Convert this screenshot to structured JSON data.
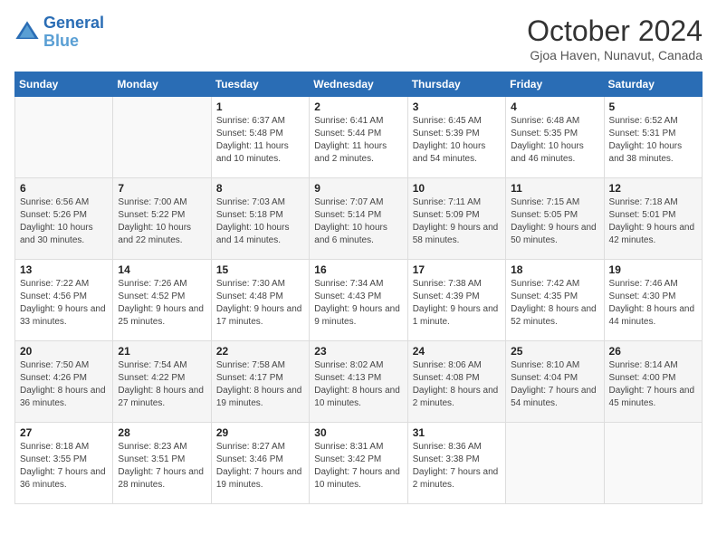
{
  "logo": {
    "line1": "General",
    "line2": "Blue"
  },
  "title": "October 2024",
  "location": "Gjoa Haven, Nunavut, Canada",
  "headers": [
    "Sunday",
    "Monday",
    "Tuesday",
    "Wednesday",
    "Thursday",
    "Friday",
    "Saturday"
  ],
  "weeks": [
    [
      {
        "day": "",
        "sunrise": "",
        "sunset": "",
        "daylight": ""
      },
      {
        "day": "",
        "sunrise": "",
        "sunset": "",
        "daylight": ""
      },
      {
        "day": "1",
        "sunrise": "Sunrise: 6:37 AM",
        "sunset": "Sunset: 5:48 PM",
        "daylight": "Daylight: 11 hours and 10 minutes."
      },
      {
        "day": "2",
        "sunrise": "Sunrise: 6:41 AM",
        "sunset": "Sunset: 5:44 PM",
        "daylight": "Daylight: 11 hours and 2 minutes."
      },
      {
        "day": "3",
        "sunrise": "Sunrise: 6:45 AM",
        "sunset": "Sunset: 5:39 PM",
        "daylight": "Daylight: 10 hours and 54 minutes."
      },
      {
        "day": "4",
        "sunrise": "Sunrise: 6:48 AM",
        "sunset": "Sunset: 5:35 PM",
        "daylight": "Daylight: 10 hours and 46 minutes."
      },
      {
        "day": "5",
        "sunrise": "Sunrise: 6:52 AM",
        "sunset": "Sunset: 5:31 PM",
        "daylight": "Daylight: 10 hours and 38 minutes."
      }
    ],
    [
      {
        "day": "6",
        "sunrise": "Sunrise: 6:56 AM",
        "sunset": "Sunset: 5:26 PM",
        "daylight": "Daylight: 10 hours and 30 minutes."
      },
      {
        "day": "7",
        "sunrise": "Sunrise: 7:00 AM",
        "sunset": "Sunset: 5:22 PM",
        "daylight": "Daylight: 10 hours and 22 minutes."
      },
      {
        "day": "8",
        "sunrise": "Sunrise: 7:03 AM",
        "sunset": "Sunset: 5:18 PM",
        "daylight": "Daylight: 10 hours and 14 minutes."
      },
      {
        "day": "9",
        "sunrise": "Sunrise: 7:07 AM",
        "sunset": "Sunset: 5:14 PM",
        "daylight": "Daylight: 10 hours and 6 minutes."
      },
      {
        "day": "10",
        "sunrise": "Sunrise: 7:11 AM",
        "sunset": "Sunset: 5:09 PM",
        "daylight": "Daylight: 9 hours and 58 minutes."
      },
      {
        "day": "11",
        "sunrise": "Sunrise: 7:15 AM",
        "sunset": "Sunset: 5:05 PM",
        "daylight": "Daylight: 9 hours and 50 minutes."
      },
      {
        "day": "12",
        "sunrise": "Sunrise: 7:18 AM",
        "sunset": "Sunset: 5:01 PM",
        "daylight": "Daylight: 9 hours and 42 minutes."
      }
    ],
    [
      {
        "day": "13",
        "sunrise": "Sunrise: 7:22 AM",
        "sunset": "Sunset: 4:56 PM",
        "daylight": "Daylight: 9 hours and 33 minutes."
      },
      {
        "day": "14",
        "sunrise": "Sunrise: 7:26 AM",
        "sunset": "Sunset: 4:52 PM",
        "daylight": "Daylight: 9 hours and 25 minutes."
      },
      {
        "day": "15",
        "sunrise": "Sunrise: 7:30 AM",
        "sunset": "Sunset: 4:48 PM",
        "daylight": "Daylight: 9 hours and 17 minutes."
      },
      {
        "day": "16",
        "sunrise": "Sunrise: 7:34 AM",
        "sunset": "Sunset: 4:43 PM",
        "daylight": "Daylight: 9 hours and 9 minutes."
      },
      {
        "day": "17",
        "sunrise": "Sunrise: 7:38 AM",
        "sunset": "Sunset: 4:39 PM",
        "daylight": "Daylight: 9 hours and 1 minute."
      },
      {
        "day": "18",
        "sunrise": "Sunrise: 7:42 AM",
        "sunset": "Sunset: 4:35 PM",
        "daylight": "Daylight: 8 hours and 52 minutes."
      },
      {
        "day": "19",
        "sunrise": "Sunrise: 7:46 AM",
        "sunset": "Sunset: 4:30 PM",
        "daylight": "Daylight: 8 hours and 44 minutes."
      }
    ],
    [
      {
        "day": "20",
        "sunrise": "Sunrise: 7:50 AM",
        "sunset": "Sunset: 4:26 PM",
        "daylight": "Daylight: 8 hours and 36 minutes."
      },
      {
        "day": "21",
        "sunrise": "Sunrise: 7:54 AM",
        "sunset": "Sunset: 4:22 PM",
        "daylight": "Daylight: 8 hours and 27 minutes."
      },
      {
        "day": "22",
        "sunrise": "Sunrise: 7:58 AM",
        "sunset": "Sunset: 4:17 PM",
        "daylight": "Daylight: 8 hours and 19 minutes."
      },
      {
        "day": "23",
        "sunrise": "Sunrise: 8:02 AM",
        "sunset": "Sunset: 4:13 PM",
        "daylight": "Daylight: 8 hours and 10 minutes."
      },
      {
        "day": "24",
        "sunrise": "Sunrise: 8:06 AM",
        "sunset": "Sunset: 4:08 PM",
        "daylight": "Daylight: 8 hours and 2 minutes."
      },
      {
        "day": "25",
        "sunrise": "Sunrise: 8:10 AM",
        "sunset": "Sunset: 4:04 PM",
        "daylight": "Daylight: 7 hours and 54 minutes."
      },
      {
        "day": "26",
        "sunrise": "Sunrise: 8:14 AM",
        "sunset": "Sunset: 4:00 PM",
        "daylight": "Daylight: 7 hours and 45 minutes."
      }
    ],
    [
      {
        "day": "27",
        "sunrise": "Sunrise: 8:18 AM",
        "sunset": "Sunset: 3:55 PM",
        "daylight": "Daylight: 7 hours and 36 minutes."
      },
      {
        "day": "28",
        "sunrise": "Sunrise: 8:23 AM",
        "sunset": "Sunset: 3:51 PM",
        "daylight": "Daylight: 7 hours and 28 minutes."
      },
      {
        "day": "29",
        "sunrise": "Sunrise: 8:27 AM",
        "sunset": "Sunset: 3:46 PM",
        "daylight": "Daylight: 7 hours and 19 minutes."
      },
      {
        "day": "30",
        "sunrise": "Sunrise: 8:31 AM",
        "sunset": "Sunset: 3:42 PM",
        "daylight": "Daylight: 7 hours and 10 minutes."
      },
      {
        "day": "31",
        "sunrise": "Sunrise: 8:36 AM",
        "sunset": "Sunset: 3:38 PM",
        "daylight": "Daylight: 7 hours and 2 minutes."
      },
      {
        "day": "",
        "sunrise": "",
        "sunset": "",
        "daylight": ""
      },
      {
        "day": "",
        "sunrise": "",
        "sunset": "",
        "daylight": ""
      }
    ]
  ]
}
